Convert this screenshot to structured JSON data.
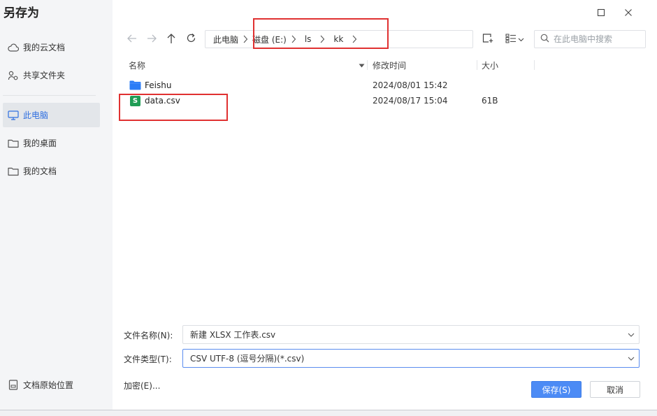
{
  "dialog": {
    "title": "另存为"
  },
  "sidebar": {
    "items": [
      {
        "label": "我的云文档",
        "icon": "cloud-icon"
      },
      {
        "label": "共享文件夹",
        "icon": "share-icon"
      },
      {
        "label": "此电脑",
        "icon": "computer-icon",
        "active": true
      },
      {
        "label": "我的桌面",
        "icon": "folder-icon"
      },
      {
        "label": "我的文档",
        "icon": "folder-icon"
      }
    ],
    "footer": {
      "label": "文档原始位置",
      "icon": "document-location-icon"
    }
  },
  "breadcrumb": {
    "parts": [
      "此电脑",
      "磁盘 (E:)",
      "ls",
      "kk"
    ]
  },
  "search": {
    "placeholder": "在此电脑中搜索"
  },
  "columns": {
    "name": "名称",
    "modified": "修改时间",
    "size": "大小"
  },
  "files": [
    {
      "name": "Feishu",
      "modified": "2024/08/01 15:42",
      "size": "",
      "type": "folder"
    },
    {
      "name": "data.csv",
      "modified": "2024/08/17 15:04",
      "size": "61B",
      "type": "csv",
      "icon_letter": "S"
    }
  ],
  "form": {
    "filename_label": "文件名称(N):",
    "filename_value": "新建 XLSX 工作表.csv",
    "filetype_label": "文件类型(T):",
    "filetype_value": "CSV UTF-8 (逗号分隔)(*.csv)",
    "encrypt_label": "加密(E)..."
  },
  "buttons": {
    "save": "保存(S)",
    "cancel": "取消"
  },
  "colors": {
    "accent": "#4c8bf5",
    "annotation": "#e03131",
    "csv_icon": "#1f9d55",
    "folder_icon": "#2b7cf6"
  }
}
